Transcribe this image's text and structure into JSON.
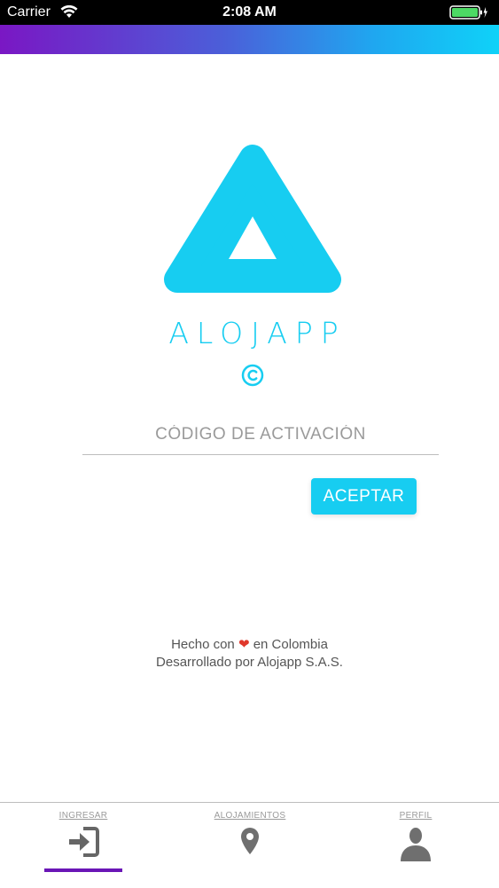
{
  "status_bar": {
    "carrier": "Carrier",
    "time": "2:08 AM",
    "battery_color": "#4cd964"
  },
  "brand": {
    "name": "ALOJAPP",
    "accent_color": "#17cdf1",
    "logo_icon": "triangle-logo-icon",
    "copyright_icon": "copyright-icon"
  },
  "form": {
    "code_placeholder": "CÓDIGO DE ACTIVACIÓN",
    "code_value": "",
    "accept_label": "ACEPTAR"
  },
  "footer": {
    "made_with": "Hecho con",
    "heart_icon": "heart-icon",
    "in_country": "en Colombia",
    "developed_by": "Desarrollado por Alojapp S.A.S."
  },
  "tab_bar": {
    "tabs": [
      {
        "label": "INGRESAR",
        "icon": "login-icon",
        "active": true
      },
      {
        "label": "ALOJAMIENTOS",
        "icon": "location-pin-icon",
        "active": false
      },
      {
        "label": "PERFIL",
        "icon": "user-icon",
        "active": false
      }
    ],
    "active_color": "#6a16b6"
  }
}
